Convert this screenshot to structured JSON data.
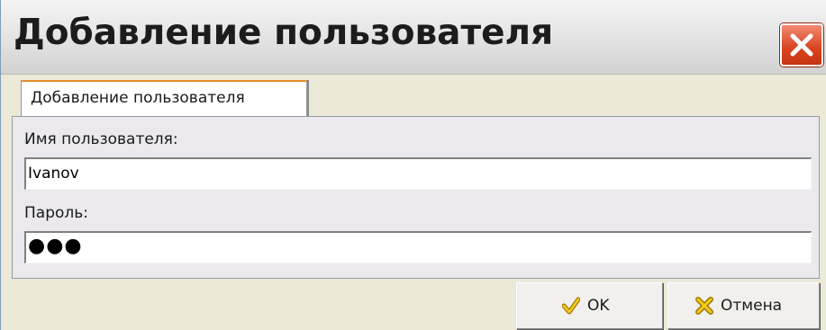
{
  "window": {
    "title": "Добавление пользователя",
    "close_icon": "close-icon"
  },
  "tabs": [
    {
      "label": "Добавление пользователя",
      "active": true
    }
  ],
  "form": {
    "username_label": "Имя пользователя:",
    "username_value": "Ivanov",
    "password_label": "Пароль:",
    "password_value": "●●●"
  },
  "buttons": {
    "ok_label": "OK",
    "ok_icon": "checkmark-icon",
    "cancel_label": "Отмена",
    "cancel_icon": "cross-icon"
  },
  "colors": {
    "close_button": "#d9431f",
    "active_tab_accent": "#e68b2c",
    "ok_icon": "#d4a800",
    "cancel_icon": "#d4a800"
  }
}
